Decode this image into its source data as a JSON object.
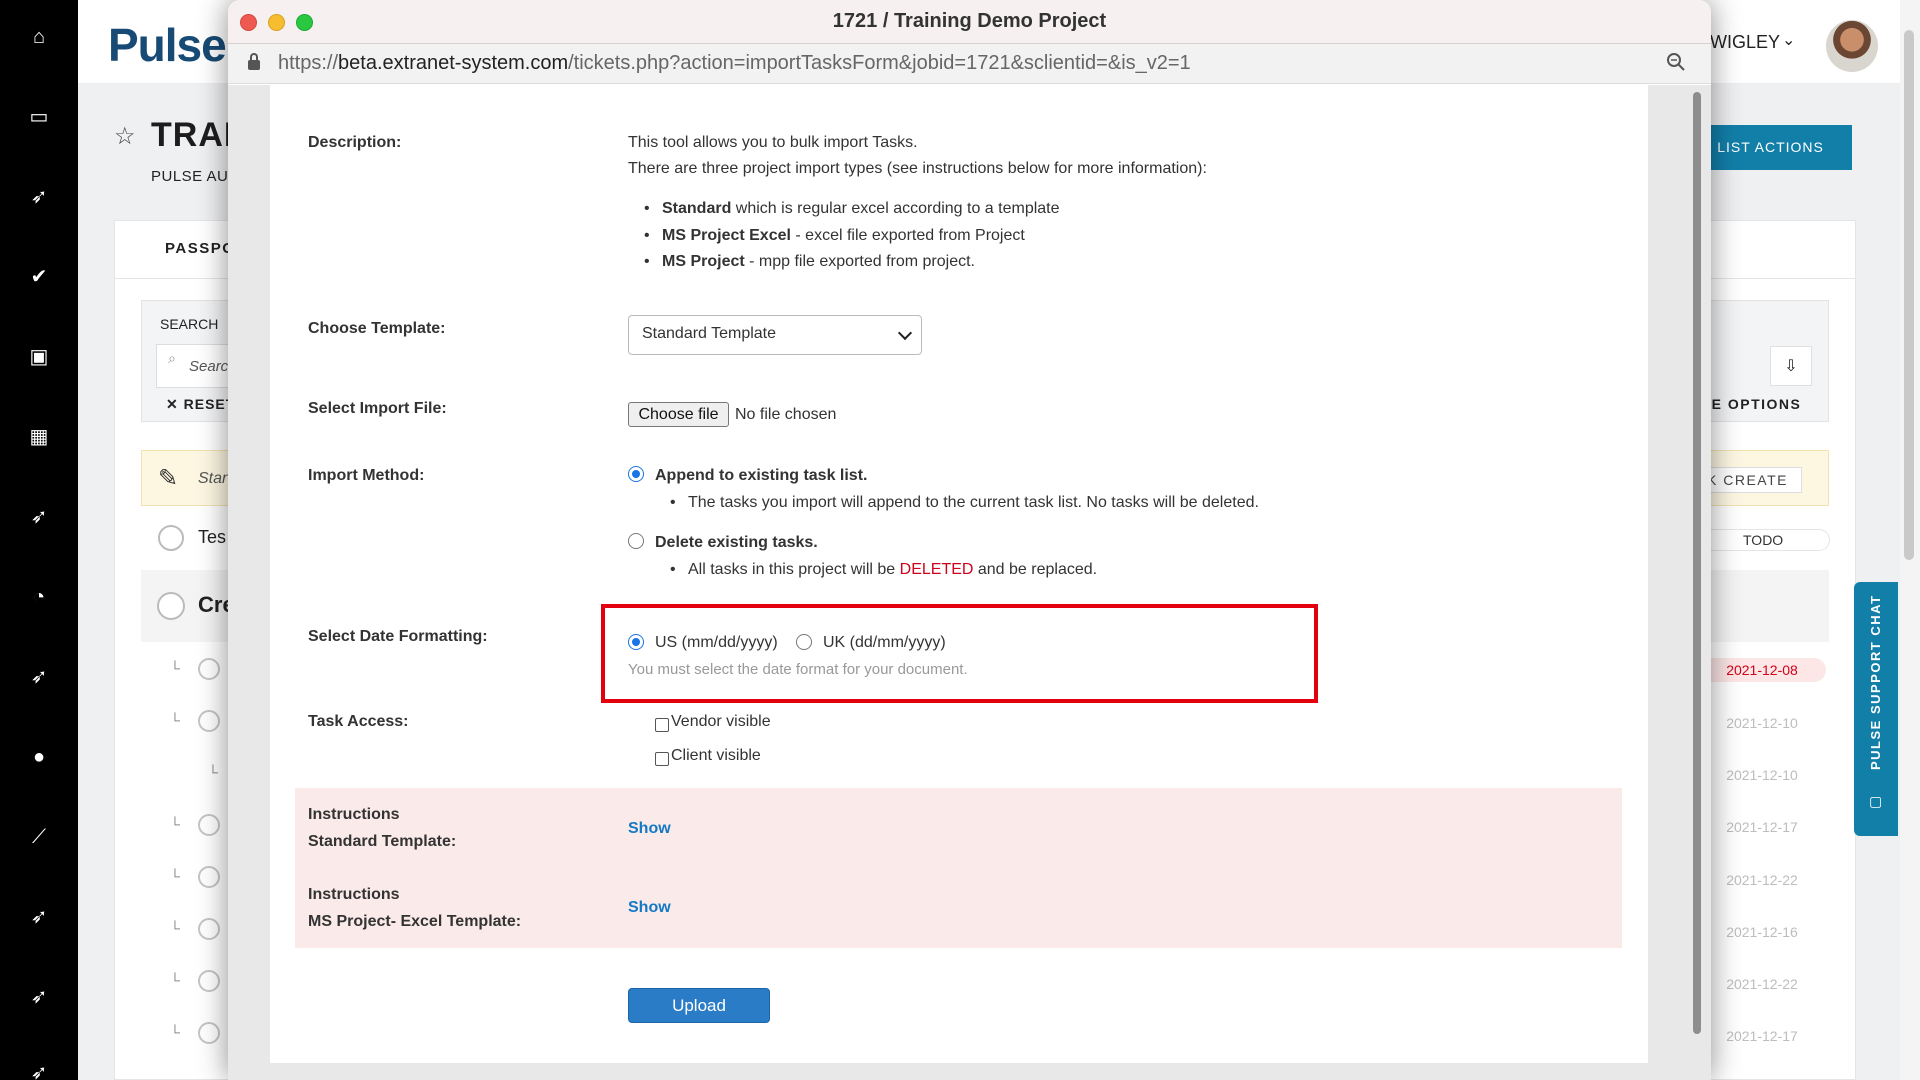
{
  "app": {
    "logo": "Pulse",
    "user_name": "WIGLEY",
    "page_title": "TRAII",
    "page_subtitle": "PULSE AU!",
    "task_list_actions": "K LIST ACTIONS",
    "tab_passport": "PASSPO",
    "search_label": "SEARCH",
    "search_placeholder": "Searcl",
    "reset_label": "RESET",
    "more_options": "RE OPTIONS",
    "quick_create_placeholder": "Star",
    "quick_create_button": "K CREATE",
    "todo_label": "TODO",
    "rows": {
      "row1": "Tes",
      "row2": "Cre"
    },
    "dates": [
      "2021-12-08",
      "2021-12-10",
      "2021-12-10",
      "2021-12-17",
      "2021-12-22",
      "2021-12-16",
      "2021-12-22",
      "2021-12-17"
    ],
    "support_chat": "PULSE SUPPORT CHAT",
    "nav_icons": [
      "home-icon",
      "inbox-icon",
      "rocket-icon",
      "check-circle-icon",
      "image-icon",
      "calendar-icon",
      "rocket-icon",
      "clock-icon",
      "rocket-icon",
      "user-icon",
      "chart-line-icon",
      "rocket-icon",
      "rocket-icon",
      "rocket-icon"
    ]
  },
  "popup": {
    "title": "1721 / Training Demo Project",
    "url_prefix": "https://",
    "url_domain": "beta.extranet-system.com",
    "url_path": "/tickets.php?action=importTasksForm&jobid=1721&sclientid=&is_v2=1",
    "description": {
      "label": "Description:",
      "line1": "This tool allows you to bulk import Tasks.",
      "line2": "There are three project import types (see instructions below for more information):",
      "bullets": [
        {
          "strong": "Standard",
          "rest": " which is regular excel according to a template"
        },
        {
          "strong": "MS Project Excel",
          "rest": " - excel file exported from Project"
        },
        {
          "strong": "MS Project",
          "rest": " - mpp file exported from project."
        }
      ]
    },
    "template": {
      "label": "Choose Template:",
      "selected": "Standard Template"
    },
    "import_file": {
      "label": "Select Import File:",
      "button": "Choose file",
      "status": "No file chosen"
    },
    "import_method": {
      "label": "Import Method:",
      "append_label": "Append to existing task list.",
      "append_desc": "The tasks you import will append to the current task list. No tasks will be deleted.",
      "delete_label": "Delete existing tasks.",
      "delete_desc_pre": "All tasks in this project will be ",
      "delete_desc_red": "DELETED",
      "delete_desc_post": " and be replaced."
    },
    "date_format": {
      "label": "Select Date Formatting:",
      "us": "US (mm/dd/yyyy)",
      "uk": "UK (dd/mm/yyyy)",
      "help": "You must select the date format for your document."
    },
    "task_access": {
      "label": "Task Access:",
      "vendor": "Vendor visible",
      "client": "Client visible"
    },
    "instructions": [
      {
        "line1": "Instructions",
        "line2": "Standard Template:",
        "link": "Show"
      },
      {
        "line1": "Instructions",
        "line2": "MS Project- Excel Template:",
        "link": "Show"
      }
    ],
    "upload": "Upload",
    "colors": {
      "deleted_red": "#d0021b",
      "highlight_box": "#e3000f",
      "link_blue": "#1479c4",
      "upload_blue": "#2a7cc7",
      "brand_teal": "#127fa9"
    }
  }
}
